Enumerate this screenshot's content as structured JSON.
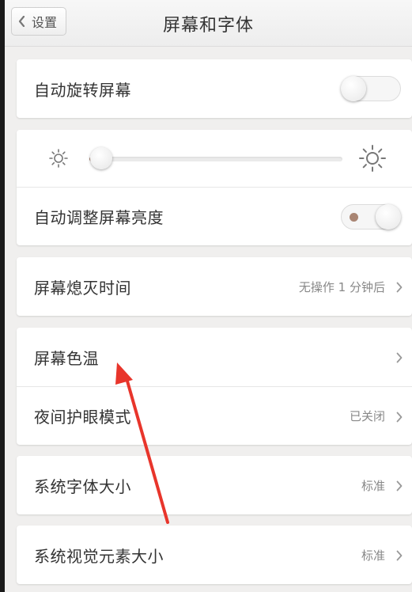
{
  "header": {
    "back_label": "设置",
    "title": "屏幕和字体"
  },
  "auto_rotate": {
    "label": "自动旋转屏幕",
    "enabled": false
  },
  "brightness": {
    "level": 0.04,
    "auto_label": "自动调整屏幕亮度",
    "auto_enabled": true
  },
  "screen_timeout": {
    "label": "屏幕熄灭时间",
    "value": "无操作 1 分钟后"
  },
  "color_temp": {
    "label": "屏幕色温"
  },
  "night_mode": {
    "label": "夜间护眼模式",
    "value": "已关闭"
  },
  "font_size": {
    "label": "系统字体大小",
    "value": "标准"
  },
  "visual_size": {
    "label": "系统视觉元素大小",
    "value": "标准"
  },
  "colors": {
    "accent": "#a98573",
    "annotation_arrow": "#e8352b"
  },
  "icons": {
    "back": "chevron-left-icon",
    "chevron": "chevron-right-icon",
    "brightness_low": "sun-small-icon",
    "brightness_high": "sun-large-icon"
  }
}
